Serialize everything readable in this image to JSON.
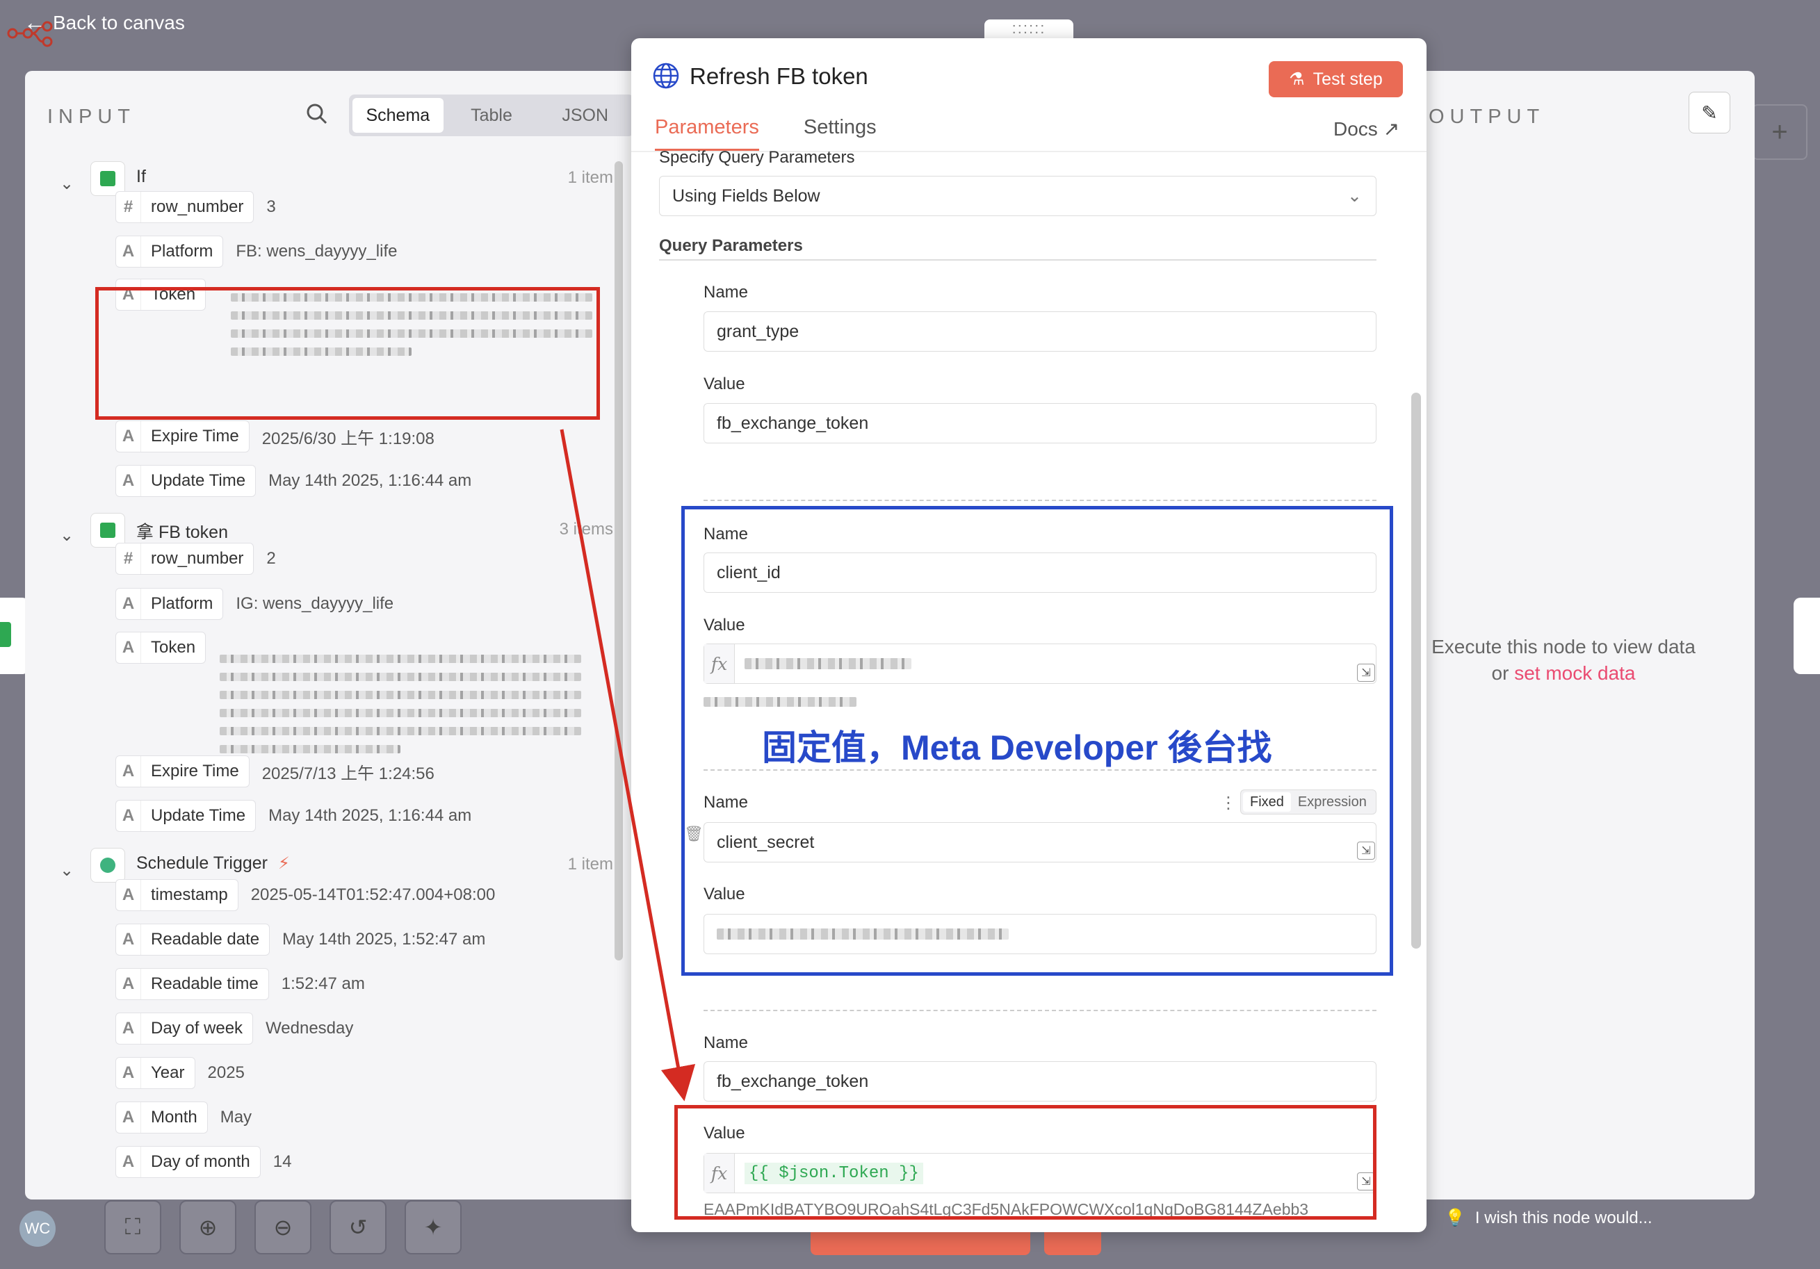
{
  "topbar": {
    "back_label": "Back to canvas"
  },
  "input_panel": {
    "title": "INPUT",
    "view_tabs": [
      "Schema",
      "Table",
      "JSON"
    ],
    "active_view": "Schema",
    "nodes": [
      {
        "name": "If",
        "count": "1 item",
        "fields": [
          {
            "type": "#",
            "name": "row_number",
            "value": "3"
          },
          {
            "type": "A",
            "name": "Platform",
            "value": "FB: wens_dayyyy_life"
          },
          {
            "type": "A",
            "name": "Token",
            "value": ""
          },
          {
            "type": "A",
            "name": "Expire Time",
            "value": "2025/6/30 上午 1:19:08"
          },
          {
            "type": "A",
            "name": "Update Time",
            "value": "May 14th 2025, 1:16:44 am"
          }
        ]
      },
      {
        "name": "拿 FB token",
        "count": "3 items",
        "fields": [
          {
            "type": "#",
            "name": "row_number",
            "value": "2"
          },
          {
            "type": "A",
            "name": "Platform",
            "value": "IG: wens_dayyyy_life"
          },
          {
            "type": "A",
            "name": "Token",
            "value": ""
          },
          {
            "type": "A",
            "name": "Expire Time",
            "value": "2025/7/13 上午 1:24:56"
          },
          {
            "type": "A",
            "name": "Update Time",
            "value": "May 14th 2025, 1:16:44 am"
          }
        ]
      },
      {
        "name": "Schedule Trigger",
        "count": "1 item",
        "fields": [
          {
            "type": "A",
            "name": "timestamp",
            "value": "2025-05-14T01:52:47.004+08:00"
          },
          {
            "type": "A",
            "name": "Readable date",
            "value": "May 14th 2025, 1:52:47 am"
          },
          {
            "type": "A",
            "name": "Readable time",
            "value": "1:52:47 am"
          },
          {
            "type": "A",
            "name": "Day of week",
            "value": "Wednesday"
          },
          {
            "type": "A",
            "name": "Year",
            "value": "2025"
          },
          {
            "type": "A",
            "name": "Month",
            "value": "May"
          },
          {
            "type": "A",
            "name": "Day of month",
            "value": "14"
          }
        ]
      }
    ]
  },
  "modal": {
    "title": "Refresh FB token",
    "test_button": "Test step",
    "tabs": [
      "Parameters",
      "Settings"
    ],
    "active_tab": "Parameters",
    "docs_label": "Docs",
    "specify_label": "Specify Query Parameters",
    "specify_value": "Using Fields Below",
    "query_params_label": "Query Parameters",
    "name_label": "Name",
    "value_label": "Value",
    "params": [
      {
        "name": "grant_type",
        "value": "fb_exchange_token"
      },
      {
        "name": "client_id",
        "value": ""
      },
      {
        "name": "client_secret",
        "value": ""
      },
      {
        "name": "fb_exchange_token",
        "value": "{{ $json.Token }}"
      }
    ],
    "toggle": [
      "Fixed",
      "Expression"
    ],
    "token_preview": "EAAPmKIdBATYBO9UROahS4tLgC3Fd5NAkFPOWCWXcol1qNqDoBG8144ZAebb3"
  },
  "output_panel": {
    "title": "OUTPUT",
    "empty_line1": "Execute this node to view data",
    "empty_or": "or",
    "empty_link": "set mock data"
  },
  "annotation": {
    "text": "固定值，Meta Developer 後台找"
  },
  "footer": {
    "wish": "I wish this node would...",
    "avatar": "WC"
  },
  "colors": {
    "accent": "#ea6b55",
    "red_box": "#d42b22",
    "blue_box": "#2749c9",
    "expr_green": "#2ea852"
  }
}
